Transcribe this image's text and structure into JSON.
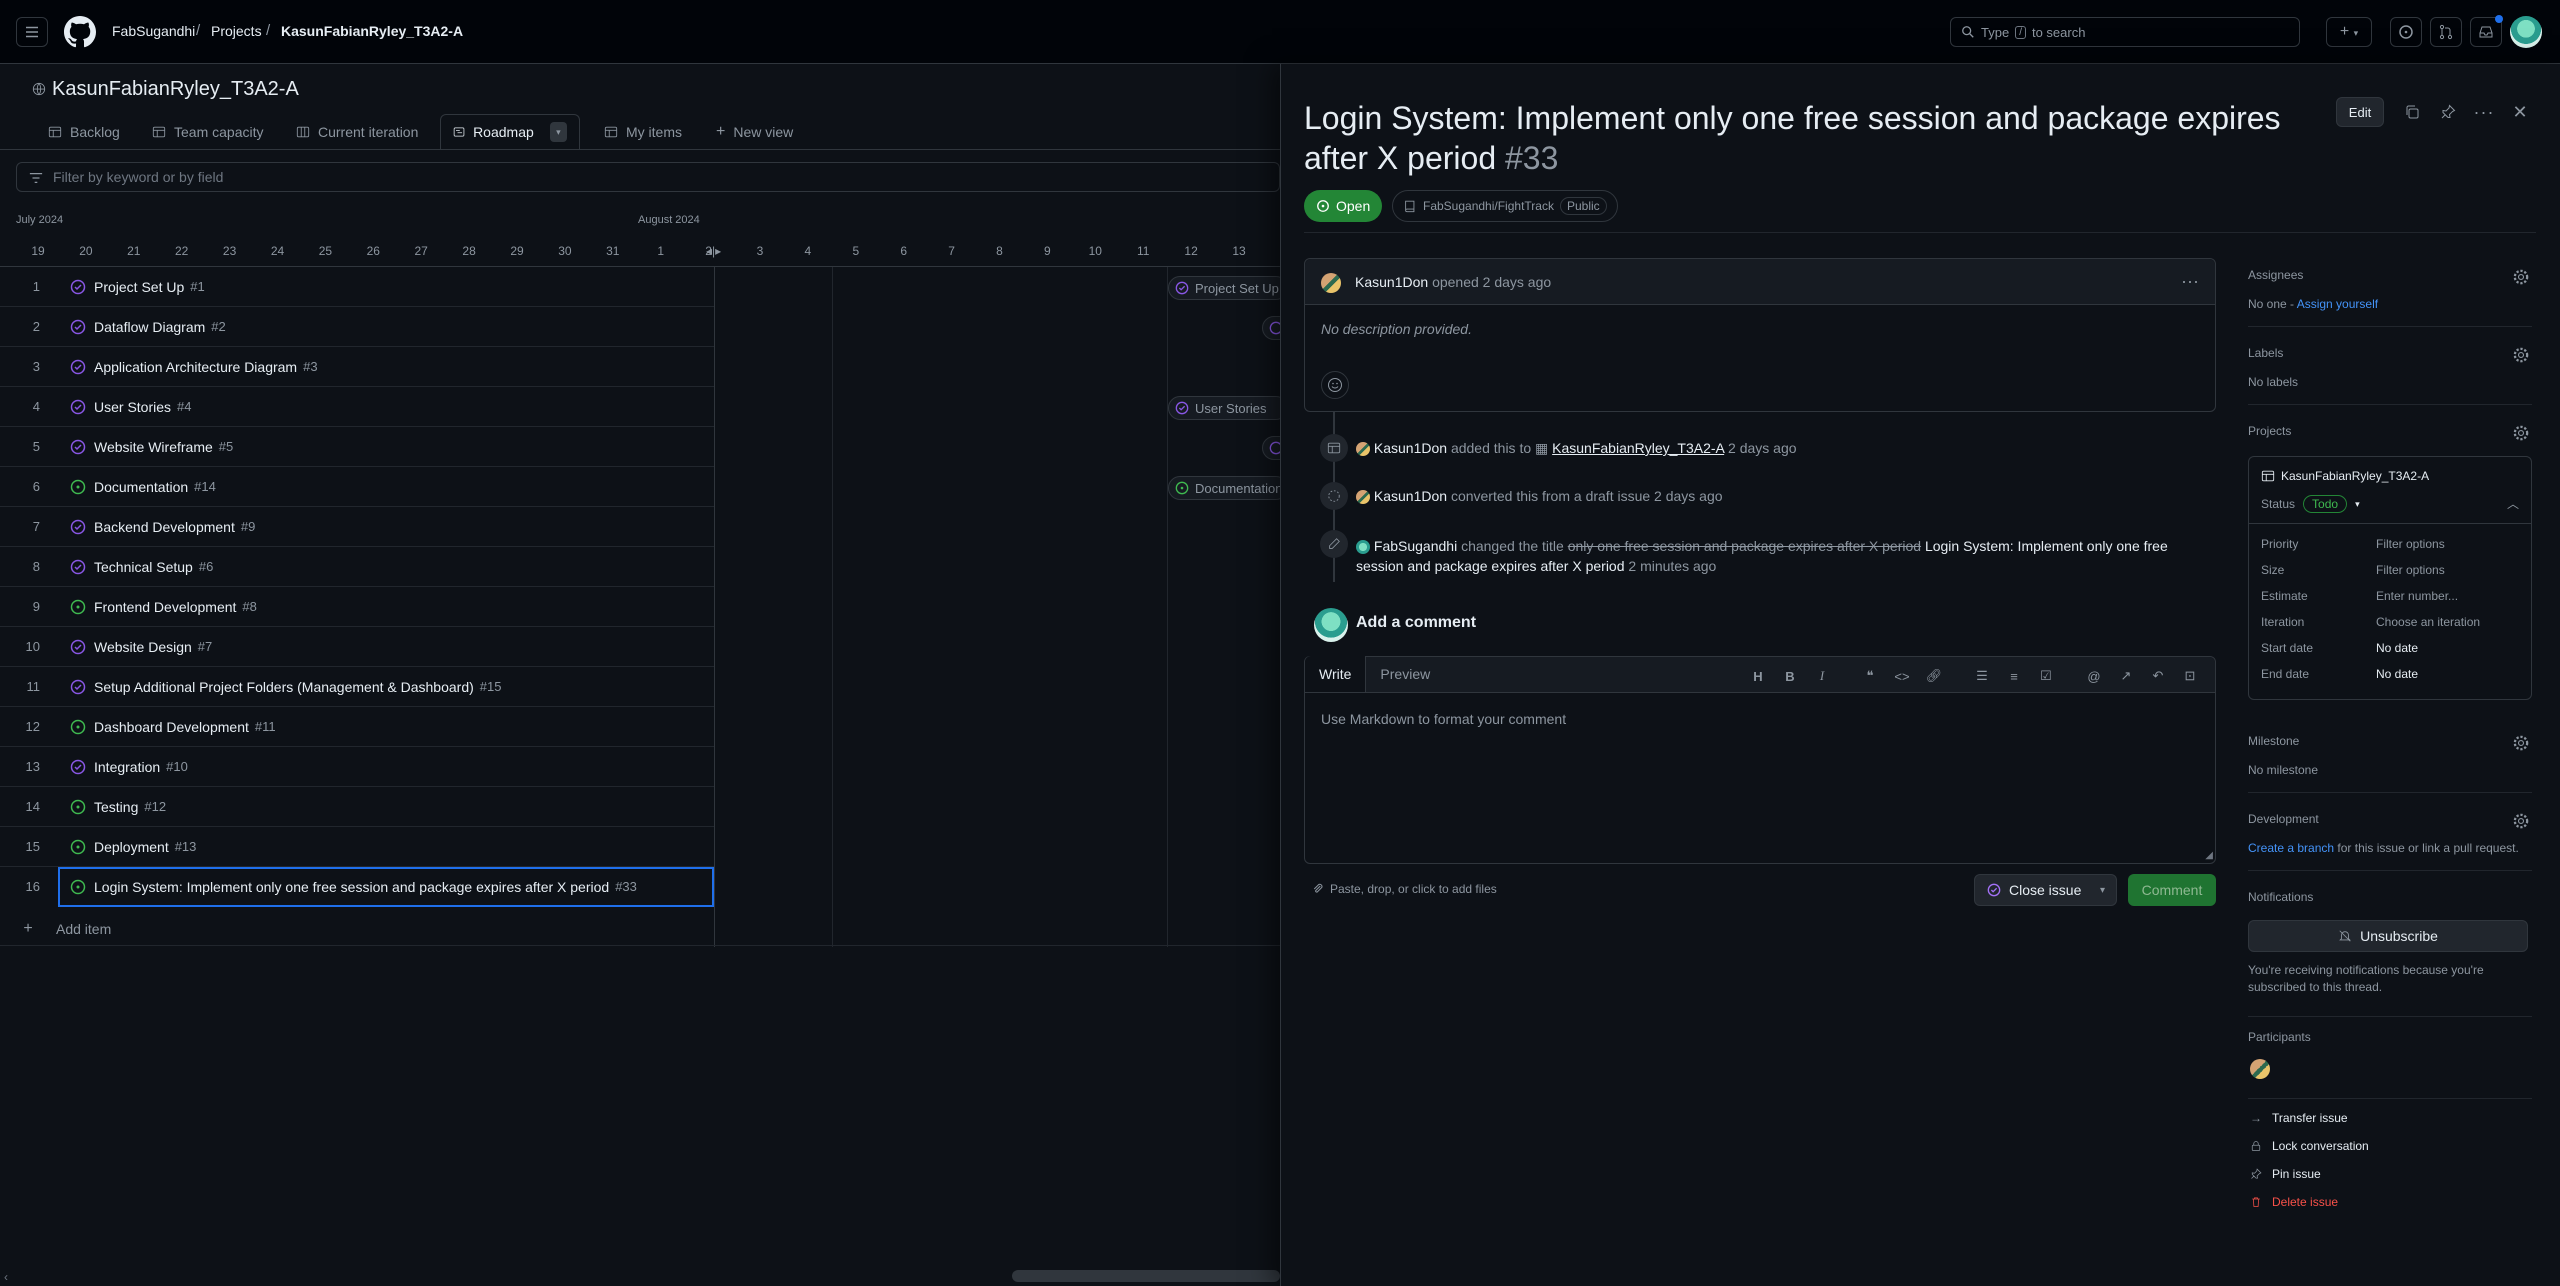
{
  "topbar": {
    "breadcrumb": [
      "FabSugandhi",
      "Projects",
      "KasunFabianRyley_T3A2-A"
    ],
    "search_placeholder_pre": "Type",
    "search_key": "/",
    "search_placeholder_post": "to search"
  },
  "project": {
    "title": "KasunFabianRyley_T3A2-A",
    "views": [
      {
        "label": "Backlog",
        "icon": "table-icon"
      },
      {
        "label": "Team capacity",
        "icon": "table-icon"
      },
      {
        "label": "Current iteration",
        "icon": "board-icon"
      },
      {
        "label": "Roadmap",
        "icon": "roadmap-icon",
        "active": true
      },
      {
        "label": "My items",
        "icon": "table-icon"
      },
      {
        "label": "New view",
        "icon": "plus-icon"
      }
    ],
    "filter_placeholder": "Filter by keyword or by field"
  },
  "timeline": {
    "months": [
      "July 2024",
      "August 2024"
    ],
    "days": [
      "19",
      "20",
      "21",
      "22",
      "23",
      "24",
      "25",
      "26",
      "27",
      "28",
      "29",
      "30",
      "31",
      "1",
      "2",
      "3",
      "4",
      "5",
      "6",
      "7",
      "8",
      "9",
      "10",
      "11",
      "12",
      "13"
    ]
  },
  "rows": [
    {
      "n": "1",
      "title": "Project Set Up",
      "ref": "#1",
      "state": "closed"
    },
    {
      "n": "2",
      "title": "Dataflow Diagram",
      "ref": "#2",
      "state": "closed"
    },
    {
      "n": "3",
      "title": "Application Architecture Diagram",
      "ref": "#3",
      "state": "closed"
    },
    {
      "n": "4",
      "title": "User Stories",
      "ref": "#4",
      "state": "closed"
    },
    {
      "n": "5",
      "title": "Website Wireframe",
      "ref": "#5",
      "state": "closed"
    },
    {
      "n": "6",
      "title": "Documentation",
      "ref": "#14",
      "state": "open"
    },
    {
      "n": "7",
      "title": "Backend Development",
      "ref": "#9",
      "state": "closed"
    },
    {
      "n": "8",
      "title": "Technical Setup",
      "ref": "#6",
      "state": "closed"
    },
    {
      "n": "9",
      "title": "Frontend Development",
      "ref": "#8",
      "state": "open"
    },
    {
      "n": "10",
      "title": "Website Design",
      "ref": "#7",
      "state": "closed"
    },
    {
      "n": "11",
      "title": "Setup Additional Project Folders (Management & Dashboard)",
      "ref": "#15",
      "state": "closed"
    },
    {
      "n": "12",
      "title": "Dashboard Development",
      "ref": "#11",
      "state": "open"
    },
    {
      "n": "13",
      "title": "Integration",
      "ref": "#10",
      "state": "closed"
    },
    {
      "n": "14",
      "title": "Testing",
      "ref": "#12",
      "state": "open"
    },
    {
      "n": "15",
      "title": "Deployment",
      "ref": "#13",
      "state": "open"
    },
    {
      "n": "16",
      "title": "Login System: Implement only one free session and package expires after X period",
      "ref": "#33",
      "state": "open",
      "selected": true
    }
  ],
  "timeline_bars": [
    "Project Set Up",
    "User Stories",
    "Documentation"
  ],
  "add_item_label": "Add item",
  "issue": {
    "title": "Login System: Implement only one free session and package expires after X period",
    "number": "#33",
    "state_label": "Open",
    "repo": "FabSugandhi/FightTrack",
    "visibility": "Public",
    "edit_label": "Edit",
    "author": "Kasun1Don",
    "opened_text": "opened 2 days ago",
    "body": "No description provided.",
    "timeline": [
      {
        "actor": "Kasun1Don",
        "action": "added this to",
        "target": "KasunFabianRyley_T3A2-A",
        "time": "2 days ago"
      },
      {
        "actor": "Kasun1Don",
        "action": "converted this from a draft issue",
        "time": "2 days ago"
      },
      {
        "actor": "FabSugandhi",
        "action": "changed the title",
        "old": "only one free session and package expires after X period",
        "new": "Login System: Implement only one free session and package expires after X period",
        "time": "2 minutes ago"
      }
    ],
    "add_comment": "Add a comment",
    "write_tab": "Write",
    "preview_tab": "Preview",
    "editor_placeholder": "Use Markdown to format your comment",
    "attach_text": "Paste, drop, or click to add files",
    "close_issue": "Close issue",
    "comment_btn": "Comment"
  },
  "sidebar": {
    "assignees_label": "Assignees",
    "assignees_value": "No one - ",
    "assign_yourself": "Assign yourself",
    "labels_label": "Labels",
    "labels_value": "No labels",
    "projects_label": "Projects",
    "project_name": "KasunFabianRyley_T3A2-A",
    "status_key": "Status",
    "status_value": "Todo",
    "fields": [
      {
        "k": "Priority",
        "v": "Filter options"
      },
      {
        "k": "Size",
        "v": "Filter options"
      },
      {
        "k": "Estimate",
        "v": "Enter number..."
      },
      {
        "k": "Iteration",
        "v": "Choose an iteration"
      },
      {
        "k": "Start date",
        "v": "No date"
      },
      {
        "k": "End date",
        "v": "No date"
      }
    ],
    "milestone_label": "Milestone",
    "milestone_value": "No milestone",
    "development_label": "Development",
    "create_branch": "Create a branch",
    "development_rest": " for this issue or link a pull request.",
    "notifications_label": "Notifications",
    "unsubscribe": "Unsubscribe",
    "notif_reason": "You're receiving notifications because you're subscribed to this thread.",
    "participants_label": "Participants",
    "actions": [
      {
        "label": "Transfer issue",
        "icon": "arrow-right-icon"
      },
      {
        "label": "Lock conversation",
        "icon": "lock-icon"
      },
      {
        "label": "Pin issue",
        "icon": "pin-icon"
      },
      {
        "label": "Delete issue",
        "icon": "trash-icon",
        "danger": true
      }
    ]
  },
  "colors": {
    "accent": "#1f6feb",
    "open_green": "#238636",
    "closed_purple": "#8957e5",
    "danger": "#f85149"
  }
}
